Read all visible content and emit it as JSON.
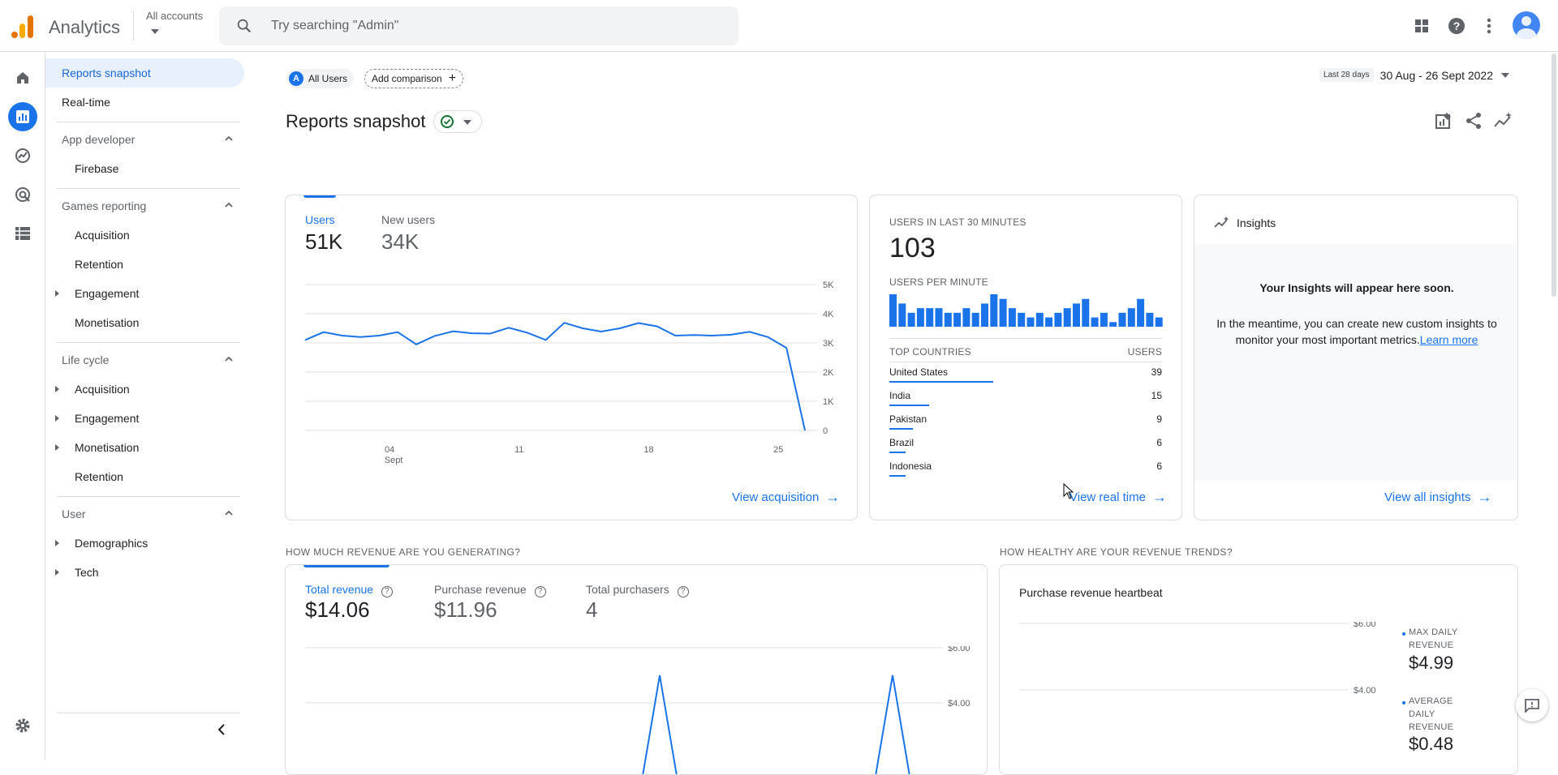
{
  "app": {
    "title": "Analytics",
    "account_label": "All accounts"
  },
  "search": {
    "placeholder": "Try searching \"Admin\""
  },
  "nav": {
    "top_items": [
      {
        "label": "Reports snapshot",
        "active": true
      },
      {
        "label": "Real-time",
        "active": false
      }
    ],
    "sections": [
      {
        "title": "App developer",
        "items": [
          {
            "label": "Firebase",
            "expandable": false
          }
        ]
      },
      {
        "title": "Games reporting",
        "items": [
          {
            "label": "Acquisition",
            "expandable": false
          },
          {
            "label": "Retention",
            "expandable": false
          },
          {
            "label": "Engagement",
            "expandable": true
          },
          {
            "label": "Monetisation",
            "expandable": false
          }
        ]
      },
      {
        "title": "Life cycle",
        "items": [
          {
            "label": "Acquisition",
            "expandable": true
          },
          {
            "label": "Engagement",
            "expandable": true
          },
          {
            "label": "Monetisation",
            "expandable": true
          },
          {
            "label": "Retention",
            "expandable": false
          }
        ]
      },
      {
        "title": "User",
        "items": [
          {
            "label": "Demographics",
            "expandable": true
          },
          {
            "label": "Tech",
            "expandable": true
          }
        ]
      }
    ]
  },
  "header": {
    "segment_chip": {
      "letter": "A",
      "label": "All Users"
    },
    "add_comparison": "Add comparison",
    "date_badge": "Last 28 days",
    "date_range": "30 Aug - 26 Sept 2022",
    "page_title": "Reports snapshot"
  },
  "users_card": {
    "metrics": [
      {
        "label": "Users",
        "value": "51K"
      },
      {
        "label": "New users",
        "value": "34K"
      }
    ],
    "link": "View acquisition",
    "y_ticks": [
      "5K",
      "4K",
      "3K",
      "2K",
      "1K",
      "0"
    ],
    "x_ticks": [
      {
        "day": "04",
        "month": "Sept"
      },
      {
        "day": "11",
        "month": ""
      },
      {
        "day": "18",
        "month": ""
      },
      {
        "day": "25",
        "month": ""
      }
    ]
  },
  "realtime_card": {
    "heading": "USERS IN LAST 30 MINUTES",
    "value": "103",
    "per_minute_label": "USERS PER MINUTE",
    "countries_header": "TOP COUNTRIES",
    "users_header": "USERS",
    "countries": [
      {
        "name": "United States",
        "users": "39"
      },
      {
        "name": "India",
        "users": "15"
      },
      {
        "name": "Pakistan",
        "users": "9"
      },
      {
        "name": "Brazil",
        "users": "6"
      },
      {
        "name": "Indonesia",
        "users": "6"
      }
    ],
    "link": "View real time"
  },
  "insights_card": {
    "title": "Insights",
    "headline": "Your Insights will appear here soon.",
    "body": "In the meantime, you can create new custom insights to monitor your most important metrics.",
    "learn_more": "Learn more",
    "link": "View all insights"
  },
  "revenue_section": {
    "heading": "HOW MUCH REVENUE ARE YOU GENERATING?",
    "metrics": [
      {
        "label": "Total revenue",
        "value": "$14.06"
      },
      {
        "label": "Purchase revenue",
        "value": "$11.96"
      },
      {
        "label": "Total purchasers",
        "value": "4"
      }
    ],
    "y_ticks": [
      "$6.00",
      "$4.00"
    ]
  },
  "trends_section": {
    "heading": "HOW HEALTHY ARE YOUR REVENUE TRENDS?",
    "card_title": "Purchase revenue heartbeat",
    "y_ticks": [
      "$6.00",
      "$4.00"
    ],
    "stats": [
      {
        "label": "MAX DAILY REVENUE",
        "value": "$4.99"
      },
      {
        "label": "AVERAGE DAILY REVENUE",
        "value": "$0.48"
      }
    ]
  },
  "chart_data": [
    {
      "type": "line",
      "series": [
        {
          "name": "Users",
          "values": [
            3100,
            3370,
            3250,
            3200,
            3250,
            3370,
            2950,
            3240,
            3400,
            3330,
            3320,
            3520,
            3350,
            3100,
            3690,
            3500,
            3390,
            3500,
            3680,
            3570,
            3250,
            3270,
            3250,
            3280,
            3380,
            3200,
            2830,
            0
          ]
        }
      ],
      "x_tick_labels": [
        "04 Sept",
        "11",
        "18",
        "25"
      ],
      "ylim": [
        0,
        5000
      ],
      "grid": true
    },
    {
      "type": "bar",
      "values": [
        7,
        5,
        3,
        4,
        4,
        4,
        3,
        3,
        4,
        3,
        5,
        7,
        6,
        4,
        3,
        2,
        3,
        2,
        3,
        4,
        5,
        6,
        2,
        3,
        1,
        3,
        4,
        6,
        3,
        2
      ],
      "grid": false
    }
  ]
}
